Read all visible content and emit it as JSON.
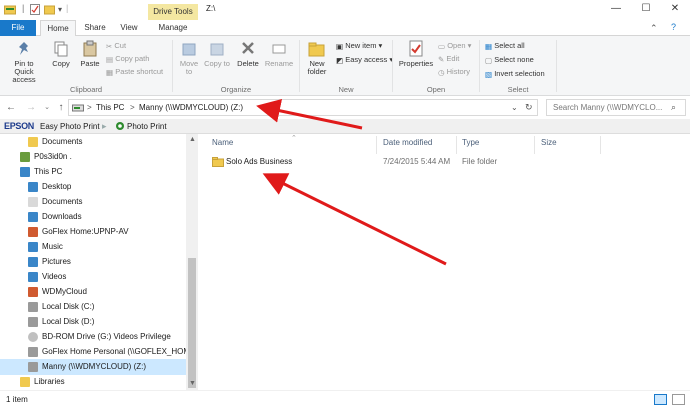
{
  "window": {
    "context_tab": "Drive Tools",
    "title": "Z:\\",
    "minimize_glyph": "—",
    "maximize_glyph": "☐",
    "close_glyph": "✕"
  },
  "tabs": [
    "File",
    "Home",
    "Share",
    "View",
    "Manage"
  ],
  "ribbon": {
    "clipboard": {
      "pin_label": "Pin to Quick access",
      "copy_label": "Copy",
      "paste_label": "Paste",
      "cut_label": "Cut",
      "copy_path_label": "Copy path",
      "paste_shortcut_label": "Paste shortcut",
      "group_label": "Clipboard"
    },
    "organize": {
      "move_to_label": "Move to",
      "copy_to_label": "Copy to",
      "delete_label": "Delete",
      "rename_label": "Rename",
      "group_label": "Organize"
    },
    "new": {
      "new_folder_label": "New folder",
      "new_item_label": "New item",
      "easy_access_label": "Easy access",
      "group_label": "New"
    },
    "open": {
      "properties_label": "Properties",
      "open_label": "Open",
      "edit_label": "Edit",
      "history_label": "History",
      "group_label": "Open"
    },
    "select": {
      "select_all_label": "Select all",
      "select_none_label": "Select none",
      "invert_label": "Invert selection",
      "group_label": "Select"
    }
  },
  "address": {
    "crumbs": [
      "This PC",
      "Manny (\\\\WDMYCLOUD) (Z:)"
    ],
    "separator": ">",
    "search_placeholder": "Search Manny (\\\\WDMYCLO..."
  },
  "epson": {
    "brand": "EPSON",
    "easy_photo_print": "Easy Photo Print",
    "photo_print": "Photo Print"
  },
  "nav": [
    {
      "label": "Documents",
      "icon": "folder-icon",
      "indent": 2
    },
    {
      "label": "P0s3id0n .",
      "icon": "user-icon",
      "indent": 1
    },
    {
      "label": "This PC",
      "icon": "computer-icon",
      "indent": 1
    },
    {
      "label": "Desktop",
      "icon": "desktop-icon",
      "indent": 2
    },
    {
      "label": "Documents",
      "icon": "documents-icon",
      "indent": 2
    },
    {
      "label": "Downloads",
      "icon": "downloads-icon",
      "indent": 2
    },
    {
      "label": "GoFlex Home:UPNP-AV",
      "icon": "media-server-icon",
      "indent": 2
    },
    {
      "label": "Music",
      "icon": "music-icon",
      "indent": 2
    },
    {
      "label": "Pictures",
      "icon": "pictures-icon",
      "indent": 2
    },
    {
      "label": "Videos",
      "icon": "videos-icon",
      "indent": 2
    },
    {
      "label": "WDMyCloud",
      "icon": "media-server-icon",
      "indent": 2
    },
    {
      "label": "Local Disk (C:)",
      "icon": "disk-icon",
      "indent": 2
    },
    {
      "label": "Local Disk (D:)",
      "icon": "disk-icon",
      "indent": 2
    },
    {
      "label": "BD-ROM Drive (G:) Videos Privilege",
      "icon": "disc-icon",
      "indent": 2
    },
    {
      "label": "GoFlex Home Personal (\\\\GOFLEX_HOME)",
      "icon": "network-drive-icon",
      "indent": 2
    },
    {
      "label": "Manny (\\\\WDMYCLOUD) (Z:)",
      "icon": "network-drive-icon",
      "indent": 2,
      "selected": true
    },
    {
      "label": "Libraries",
      "icon": "libraries-icon",
      "indent": 1
    }
  ],
  "columns": {
    "name": "Name",
    "date": "Date modified",
    "type": "Type",
    "size": "Size"
  },
  "files": [
    {
      "name": "Solo Ads Business",
      "date": "7/24/2015 5:44 AM",
      "type": "File folder",
      "size": ""
    }
  ],
  "status": {
    "count": "1 item"
  },
  "colors": {
    "file_tab": "#1979ca",
    "context_tab": "#f4e7a1",
    "selection": "#cce8ff",
    "annotation_arrow": "#e01a1a",
    "folder": "#f0c94f"
  }
}
